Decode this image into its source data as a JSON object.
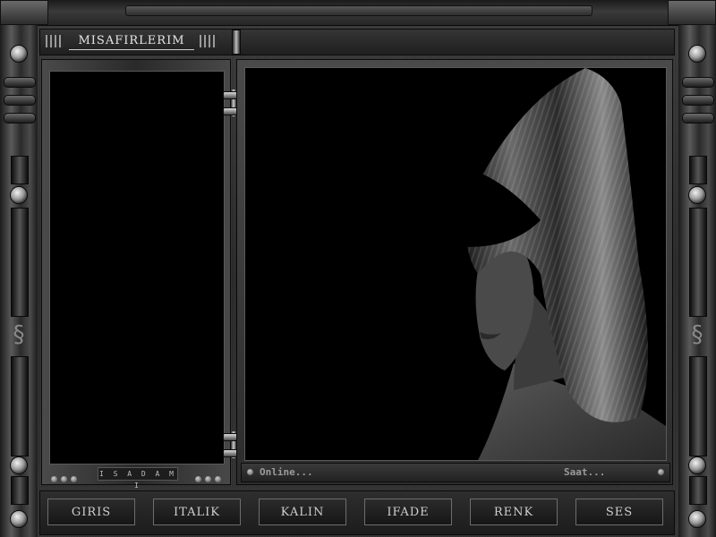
{
  "window": {
    "title": "MISAFIRLERIM"
  },
  "user_list": {
    "footer_label": "I S A D A M I"
  },
  "main_view": {
    "image_icon": "woman-portrait-image"
  },
  "status": {
    "online_label": "Online...",
    "clock_label": "Saat..."
  },
  "toolbar": {
    "buttons": [
      {
        "label": "GIRIS"
      },
      {
        "label": "ITALIK"
      },
      {
        "label": "KALIN"
      },
      {
        "label": "IFADE"
      },
      {
        "label": "RENK"
      },
      {
        "label": "SES"
      }
    ]
  },
  "colors": {
    "chrome_dark": "#1a1a1a",
    "chrome_light": "#6a6a6a",
    "screen": "#000000",
    "text": "#cfcfcf"
  }
}
